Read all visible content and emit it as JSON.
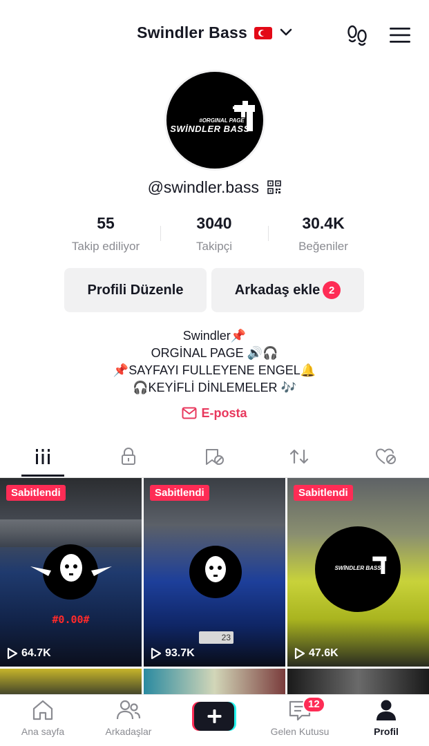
{
  "header": {
    "username": "Swindler Bass",
    "flag_icon": "turkey-flag-icon",
    "dropdown_icon": "chevron-down-icon",
    "footprint_icon": "footprints-icon",
    "menu_icon": "hamburger-menu-icon"
  },
  "avatar": {
    "line1": "#ORGINAL PAGE",
    "line2": "SWİNDLER BASS"
  },
  "profile": {
    "handle": "@swindler.bass",
    "qr_icon": "qr-code-icon"
  },
  "stats": [
    {
      "value": "55",
      "label": "Takip ediliyor"
    },
    {
      "value": "3040",
      "label": "Takipçi"
    },
    {
      "value": "30.4K",
      "label": "Beğeniler"
    }
  ],
  "actions": {
    "edit_profile": "Profili Düzenle",
    "add_friend": "Arkadaş ekle",
    "add_friend_badge": "2"
  },
  "bio": {
    "line1": "Swindler📌",
    "line2": "ORGİNAL PAGE 🔊🎧",
    "line3": "📌SAYFAYI FULLEYENE ENGEL🔔",
    "line4": "🎧KEYİFLİ DİNLEMELER 🎶"
  },
  "email": {
    "label": "E-posta",
    "icon": "mail-icon",
    "color": "#e8385d"
  },
  "tabs": [
    {
      "icon": "videos-grid-icon",
      "active": true
    },
    {
      "icon": "lock-icon",
      "active": false
    },
    {
      "icon": "saved-hidden-icon",
      "active": false
    },
    {
      "icon": "repost-icon",
      "active": false
    },
    {
      "icon": "liked-hidden-icon",
      "active": false
    }
  ],
  "videos": [
    {
      "pinned_label": "Sabitlendi",
      "views": "64.7K",
      "overlay_text": "#0.00#"
    },
    {
      "pinned_label": "Sabitlendi",
      "views": "93.7K",
      "overlay_text": "23"
    },
    {
      "pinned_label": "Sabitlendi",
      "views": "47.6K",
      "overlay_text": "SWİNDLER BASS"
    }
  ],
  "bottom_nav": {
    "home": "Ana sayfa",
    "friends": "Arkadaşlar",
    "create_icon": "plus-icon",
    "inbox": "Gelen Kutusu",
    "inbox_badge": "12",
    "profile": "Profil"
  },
  "colors": {
    "accent": "#fe2c55",
    "text": "#161823",
    "muted": "#8a8b91",
    "button_bg": "#f1f1f2"
  }
}
